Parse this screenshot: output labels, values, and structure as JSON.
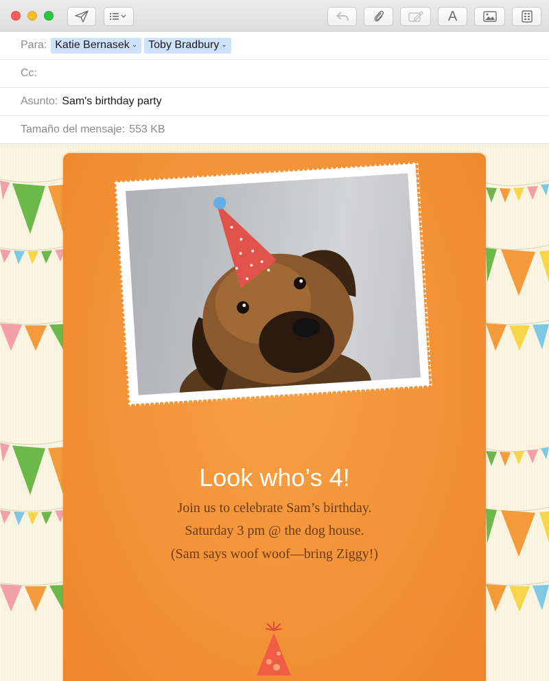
{
  "toolbar": {
    "buttons": [
      {
        "name": "send-icon"
      },
      {
        "name": "header-fields-icon"
      },
      {
        "name": "reply-icon"
      },
      {
        "name": "attachment-icon"
      },
      {
        "name": "markup-icon"
      },
      {
        "name": "format-icon"
      },
      {
        "name": "photo-browser-icon"
      },
      {
        "name": "stationery-icon"
      }
    ]
  },
  "header": {
    "to_label": "Para:",
    "recipients": [
      "Katie Bernasek",
      "Toby Bradbury"
    ],
    "cc_label": "Cc:",
    "subject_label": "Asunto:",
    "subject": "Sam's birthday party",
    "size_label": "Tamaño del mensaje:",
    "size_value": "553 KB"
  },
  "message": {
    "headline": "Look who’s 4!",
    "lines": [
      "Join us to celebrate Sam’s birthday.",
      "Saturday 3 pm @ the dog house.",
      "(Sam says woof woof—bring Ziggy!)"
    ]
  },
  "colors": {
    "card": "#f39236",
    "text_brown": "#6b3a17",
    "chip_blue": "#cfe2fb",
    "pennant_green": "#6db84a",
    "pennant_orange": "#f39a3a",
    "pennant_pink": "#f2a0a8",
    "pennant_yellow": "#f7d54a",
    "pennant_blue": "#7ec8e3"
  }
}
